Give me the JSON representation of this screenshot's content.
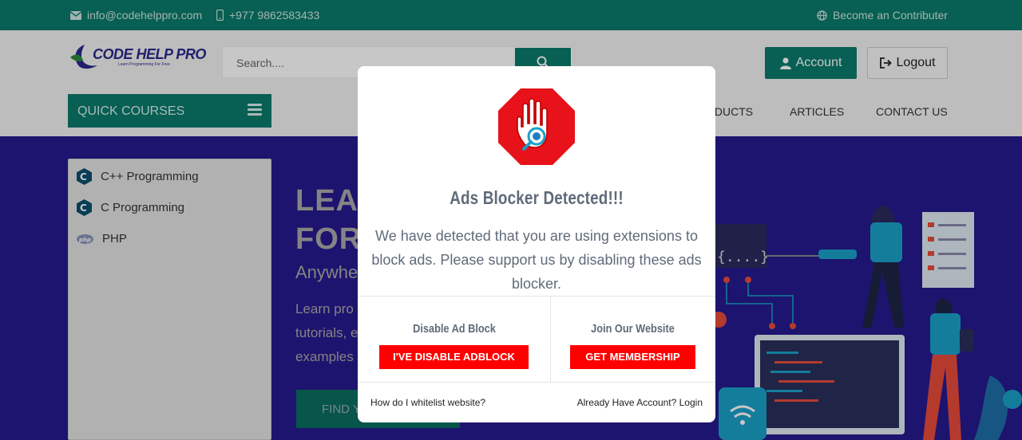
{
  "topbar": {
    "email": "info@codehelppro.com",
    "phone": "+977 9862583433",
    "contributor": "Become an Contributer"
  },
  "header": {
    "logo_title": "CODE HELP PRO",
    "logo_subtitle": "Learn Programming For Free",
    "search_placeholder": "Search....",
    "account_label": "Account",
    "logout_label": "Logout"
  },
  "nav": {
    "quick_courses": "QUICK COURSES",
    "items": [
      "ODUCTS",
      "ARTICLES",
      "CONTACT US"
    ]
  },
  "sidebar": {
    "items": [
      {
        "label": "C++ Programming",
        "icon": "cpp-icon"
      },
      {
        "label": "C Programming",
        "icon": "c-icon"
      },
      {
        "label": "PHP",
        "icon": "php-icon"
      }
    ]
  },
  "hero": {
    "line1": "LEA",
    "line2": "FOR",
    "sub": "Anywhe",
    "p1": "Learn pro",
    "p2": "tutorials, e",
    "p3": "examples",
    "cta": "FIND Y"
  },
  "modal": {
    "title": "Ads Blocker Detected!!!",
    "text": "We have detected that you are using extensions to block ads. Please support us by disabling these ads blocker.",
    "left_heading": "Disable Ad Block",
    "left_button": "I'VE DISABLE ADBLOCK",
    "right_heading": "Join Our Website",
    "right_button": "GET MEMBERSHIP",
    "footer_left": "How do I whitelist website?",
    "footer_right": "Already Have Account? Login"
  },
  "colors": {
    "brand": "#0b7a6b",
    "hero_bg": "#261a8f",
    "alert_red": "#ff0000"
  }
}
